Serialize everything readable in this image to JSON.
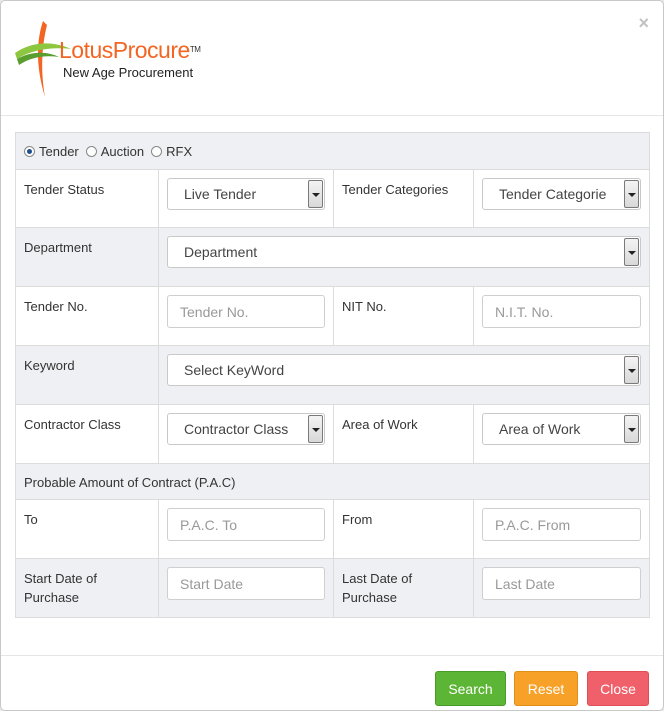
{
  "brand": {
    "name": "LotusProcure",
    "tm": "TM",
    "tagline": "New Age Procurement"
  },
  "modal": {
    "close_icon": "×"
  },
  "tender_type": {
    "options": [
      "Tender",
      "Auction",
      "RFX"
    ],
    "selected": "Tender"
  },
  "fields": {
    "tender_status": {
      "label": "Tender Status",
      "value": "Live Tender"
    },
    "tender_categories": {
      "label": "Tender Categories",
      "value": "Tender Categorie"
    },
    "department": {
      "label": "Department",
      "value": "Department"
    },
    "tender_no": {
      "label": "Tender No.",
      "placeholder": "Tender No."
    },
    "nit_no": {
      "label": "NIT No.",
      "placeholder": "N.I.T. No."
    },
    "keyword": {
      "label": "Keyword",
      "value": "Select KeyWord"
    },
    "contractor_class": {
      "label": "Contractor Class",
      "value": "Contractor Class"
    },
    "area_of_work": {
      "label": "Area of Work",
      "value": "Area of Work"
    },
    "pac_header": "Probable Amount of Contract (P.A.C)",
    "pac_to": {
      "label": "To",
      "placeholder": "P.A.C. To"
    },
    "pac_from": {
      "label": "From",
      "placeholder": "P.A.C. From"
    },
    "start_date": {
      "label": "Start Date of Purchase",
      "placeholder": "Start Date"
    },
    "last_date": {
      "label": "Last Date of Purchase",
      "placeholder": "Last Date"
    }
  },
  "buttons": {
    "search": "Search",
    "reset": "Reset",
    "close": "Close"
  },
  "colors": {
    "search": "#5cb535",
    "reset": "#f7a128",
    "close": "#f0606a",
    "brand": "#f26522"
  }
}
